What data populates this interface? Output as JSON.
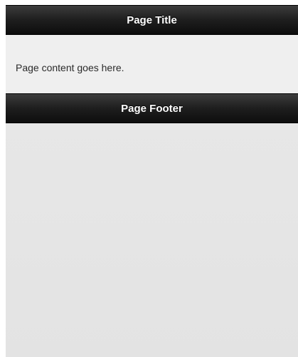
{
  "header": {
    "title": "Page Title"
  },
  "content": {
    "text": "Page content goes here."
  },
  "footer": {
    "title": "Page Footer"
  }
}
